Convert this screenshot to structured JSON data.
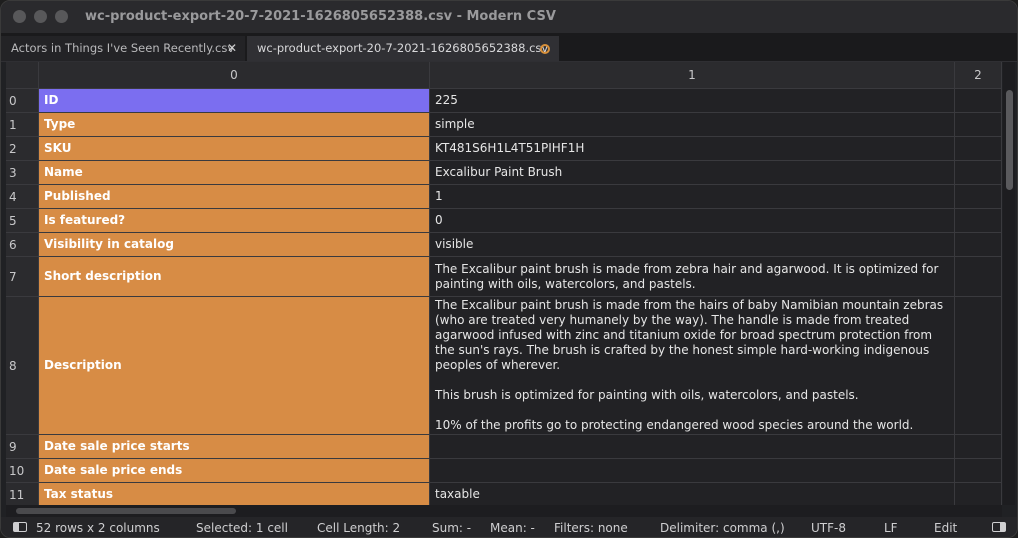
{
  "window": {
    "title": "wc-product-export-20-7-2021-1626805652388.csv - Modern CSV"
  },
  "tabs": [
    {
      "label": "Actors in Things I've Seen Recently.csv",
      "close": "✕"
    },
    {
      "label": "wc-product-export-20-7-2021-1626805652388.csv"
    }
  ],
  "grid": {
    "columns": [
      "0",
      "1",
      "2"
    ],
    "rows": [
      {
        "index": "0",
        "key": "ID",
        "value": "225"
      },
      {
        "index": "1",
        "key": "Type",
        "value": "simple"
      },
      {
        "index": "2",
        "key": "SKU",
        "value": "KT481S6H1L4T51PIHF1H"
      },
      {
        "index": "3",
        "key": "Name",
        "value": "Excalibur Paint Brush"
      },
      {
        "index": "4",
        "key": "Published",
        "value": "1"
      },
      {
        "index": "5",
        "key": "Is featured?",
        "value": "0"
      },
      {
        "index": "6",
        "key": "Visibility in catalog",
        "value": "visible"
      },
      {
        "index": "7",
        "key": "Short description",
        "value": "The Excalibur paint brush is made from zebra hair and agarwood. It is optimized for painting with oils, watercolors, and pastels."
      },
      {
        "index": "8",
        "key": "Description",
        "value": "The Excalibur paint brush is made from the hairs of baby Namibian mountain zebras (who are treated very humanely by the way). The handle is made from treated agarwood infused with zinc and titanium oxide for broad spectrum protection from the sun's rays. The brush is crafted by the honest simple hard-working indigenous peoples of wherever.\n\nThis brush is optimized for painting with oils, watercolors, and pastels.\n\n10% of the profits go to protecting endangered wood species around the world."
      },
      {
        "index": "9",
        "key": "Date sale price starts",
        "value": ""
      },
      {
        "index": "10",
        "key": "Date sale price ends",
        "value": ""
      },
      {
        "index": "11",
        "key": "Tax status",
        "value": "taxable"
      }
    ]
  },
  "status": {
    "rows_cols": "52 rows x 2 columns",
    "selected": "Selected: 1 cell",
    "cell_length": "Cell Length: 2",
    "sum": "Sum: -",
    "mean": "Mean: -",
    "filters": "Filters: none",
    "delimiter": "Delimiter: comma (,)",
    "encoding": "UTF-8",
    "line_ending": "LF",
    "mode": "Edit"
  },
  "colors": {
    "key_column": "#d78c45",
    "selected_cell": "#7b6ef0",
    "modified_dot": "#d8903a"
  }
}
